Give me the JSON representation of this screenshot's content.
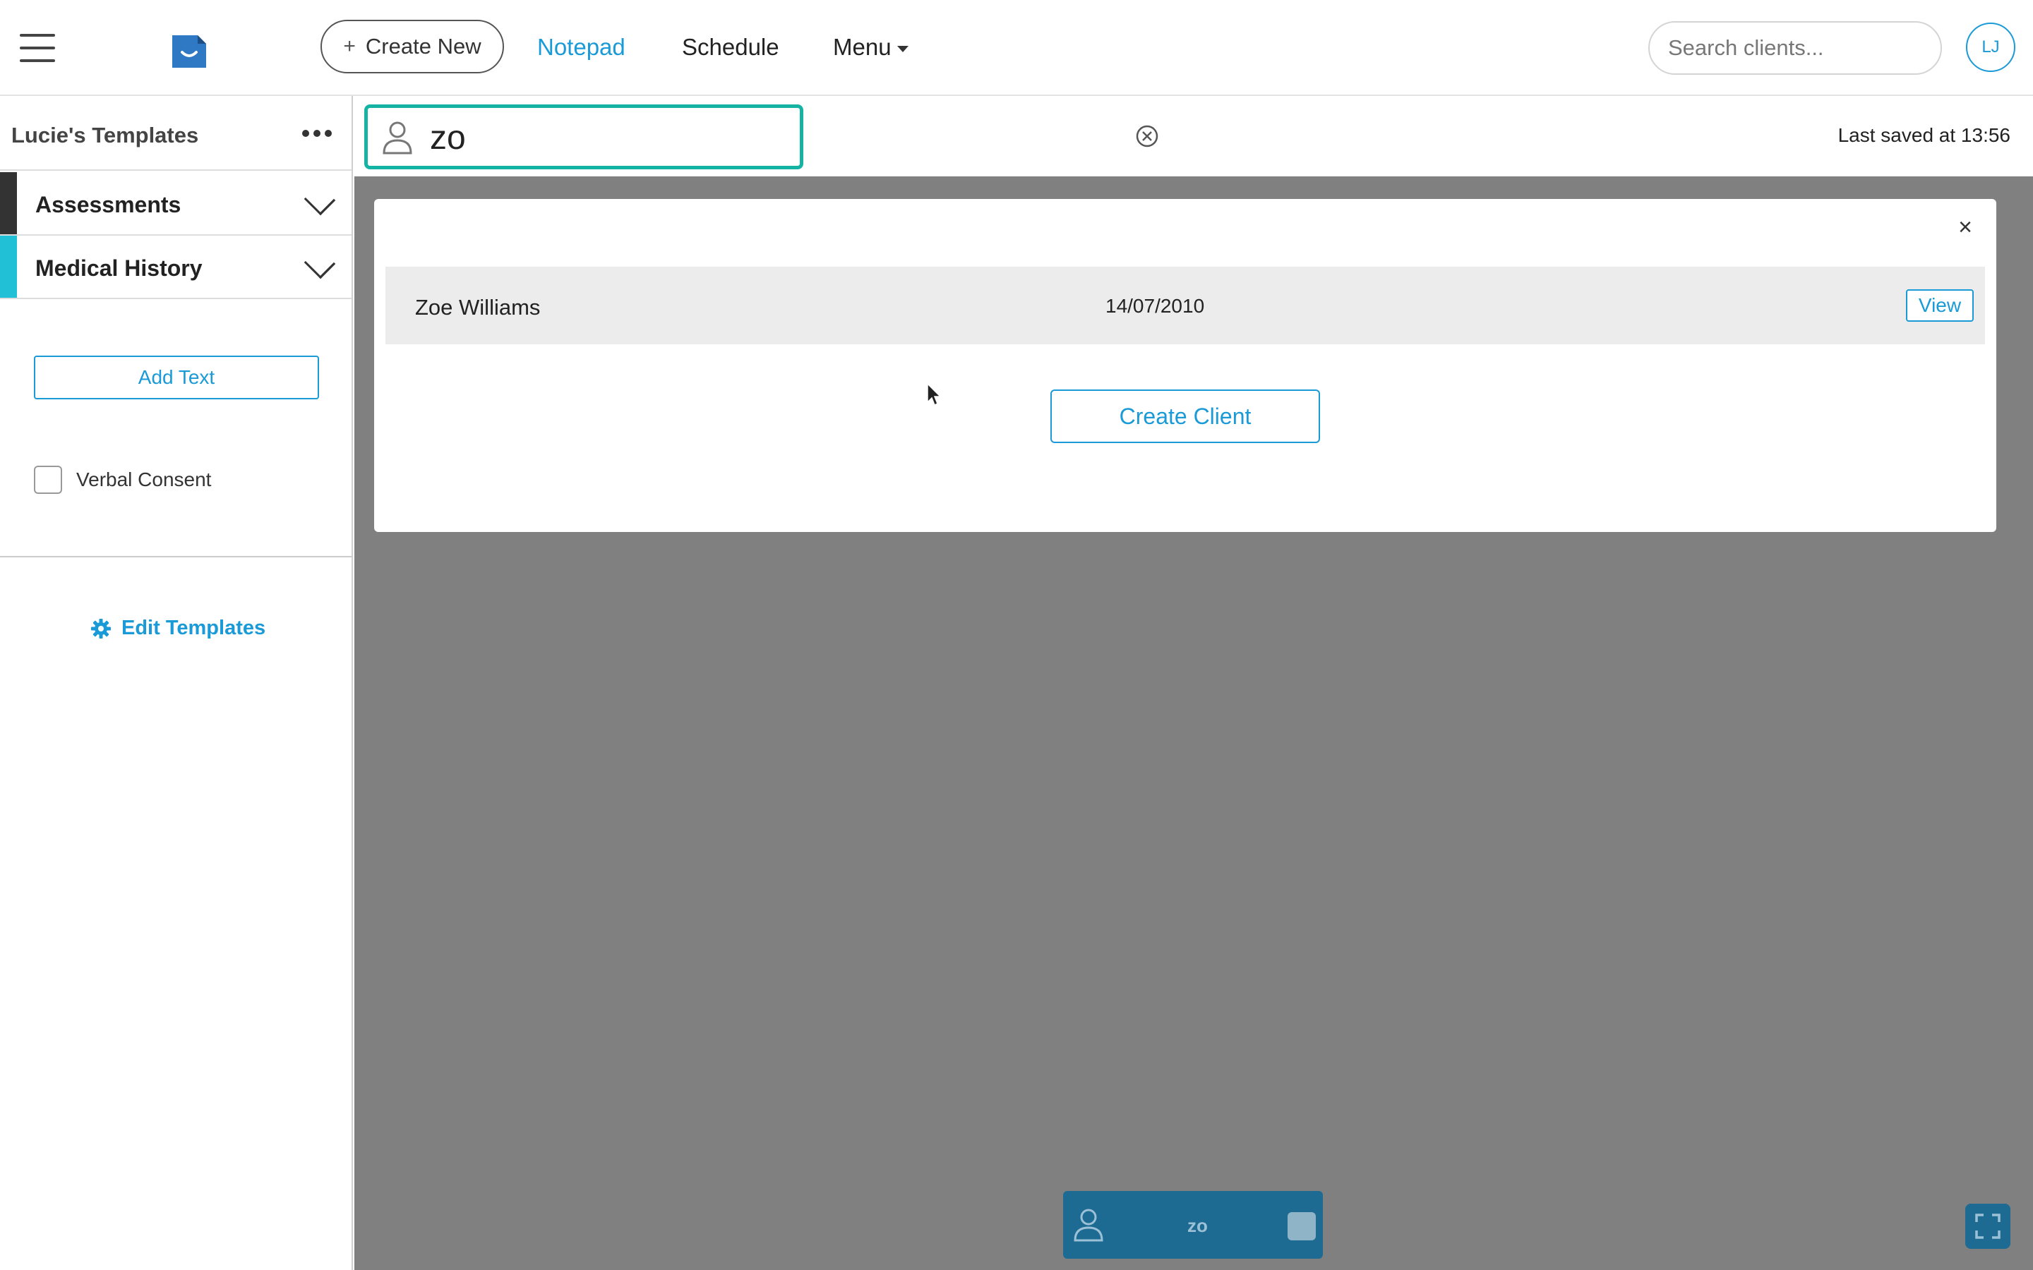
{
  "topnav": {
    "create_new_label": "Create New",
    "links": {
      "notepad": "Notepad",
      "schedule": "Schedule",
      "menu": "Menu"
    },
    "search_placeholder": "Search clients...",
    "avatar_initials": "LJ",
    "accent_color": "#1a9ad6"
  },
  "sidebar": {
    "title": "Lucie's Templates",
    "categories": [
      {
        "label": "Assessments",
        "color": "#333333"
      },
      {
        "label": "Medical History",
        "color": "#22c0d6"
      }
    ],
    "add_text_label": "Add Text",
    "verbal_consent_label": "Verbal Consent",
    "edit_templates_label": "Edit Templates"
  },
  "client_bar": {
    "search_value": "zo",
    "last_saved": "Last saved at 13:56",
    "focus_color": "#15b3a4"
  },
  "modal": {
    "results": [
      {
        "name": "Zoe Williams",
        "dob": "14/07/2010",
        "action": "View"
      }
    ],
    "create_client_label": "Create Client",
    "close_symbol": "×"
  },
  "bottom_bar": {
    "client_text": "zo"
  }
}
